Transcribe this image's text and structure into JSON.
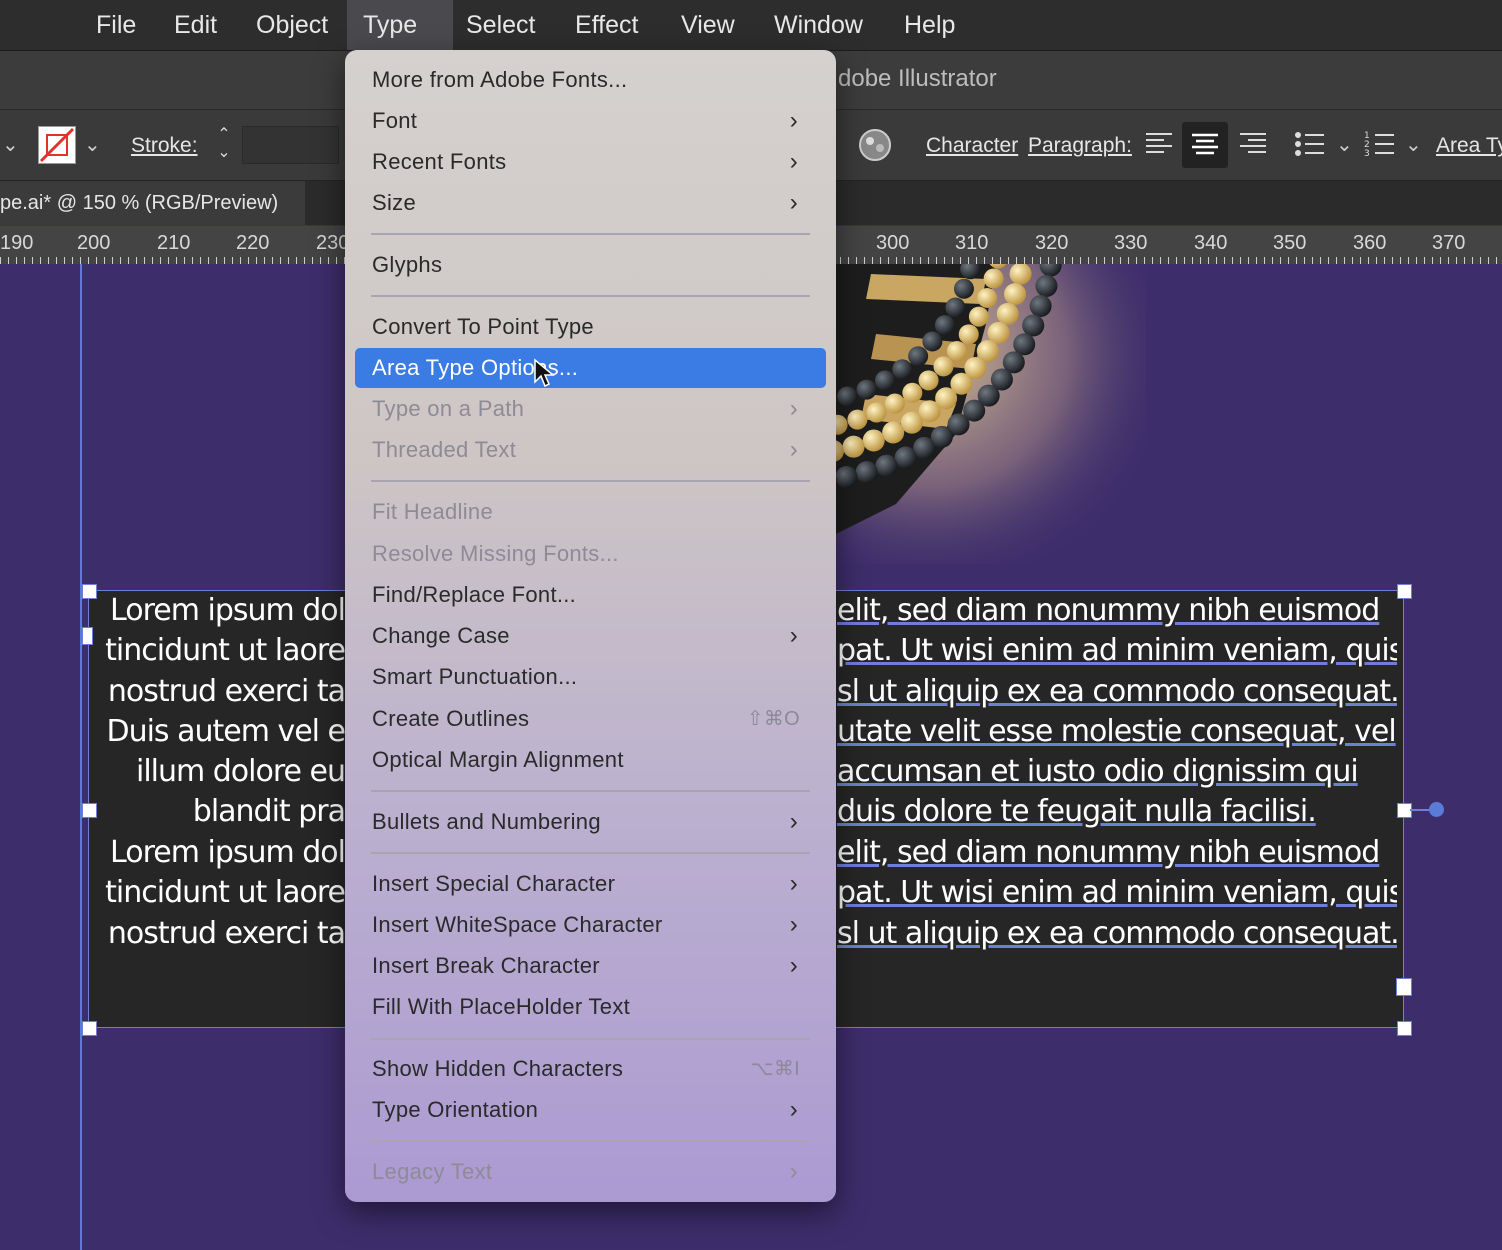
{
  "menubar": {
    "items": [
      "File",
      "Edit",
      "Object",
      "Type",
      "Select",
      "Effect",
      "View",
      "Window",
      "Help"
    ],
    "active": "Type"
  },
  "titlebar": {
    "title": "dobe Illustrator"
  },
  "controlbar": {
    "stroke_label": "Stroke:",
    "character_label": "Character",
    "paragraph_label": "Paragraph:",
    "area_label": "Area Ty"
  },
  "document": {
    "tab_label": "pe.ai* @ 150 % (RGB/Preview)"
  },
  "ruler": {
    "labels": [
      "190",
      "200",
      "210",
      "220",
      "230",
      "300",
      "310",
      "320",
      "330",
      "340",
      "350",
      "360",
      "370"
    ]
  },
  "type_menu": {
    "items": [
      {
        "label": "More from Adobe Fonts...",
        "submenu": false,
        "disabled": false
      },
      {
        "label": "Font",
        "submenu": true,
        "disabled": false
      },
      {
        "label": "Recent Fonts",
        "submenu": true,
        "disabled": false
      },
      {
        "label": "Size",
        "submenu": true,
        "disabled": false
      },
      {
        "label": "Glyphs",
        "submenu": false,
        "disabled": false
      },
      {
        "label": "Convert To Point Type",
        "submenu": false,
        "disabled": false
      },
      {
        "label": "Area Type Options...",
        "submenu": false,
        "disabled": false,
        "selected": true
      },
      {
        "label": "Type on a Path",
        "submenu": true,
        "disabled": true
      },
      {
        "label": "Threaded Text",
        "submenu": true,
        "disabled": true
      },
      {
        "label": "Fit Headline",
        "submenu": false,
        "disabled": true
      },
      {
        "label": "Resolve Missing Fonts...",
        "submenu": false,
        "disabled": true
      },
      {
        "label": "Find/Replace Font...",
        "submenu": false,
        "disabled": false
      },
      {
        "label": "Change Case",
        "submenu": true,
        "disabled": false
      },
      {
        "label": "Smart Punctuation...",
        "submenu": false,
        "disabled": false
      },
      {
        "label": "Create Outlines",
        "submenu": false,
        "disabled": false,
        "shortcut": "⇧⌘O"
      },
      {
        "label": "Optical Margin Alignment",
        "submenu": false,
        "disabled": false
      },
      {
        "label": "Bullets and Numbering",
        "submenu": true,
        "disabled": false
      },
      {
        "label": "Insert Special Character",
        "submenu": true,
        "disabled": false
      },
      {
        "label": "Insert WhiteSpace Character",
        "submenu": true,
        "disabled": false
      },
      {
        "label": "Insert Break Character",
        "submenu": true,
        "disabled": false
      },
      {
        "label": "Fill With PlaceHolder Text",
        "submenu": false,
        "disabled": false
      },
      {
        "label": "Show Hidden Characters",
        "submenu": false,
        "disabled": false,
        "shortcut": "⌥⌘I"
      },
      {
        "label": "Type Orientation",
        "submenu": true,
        "disabled": false
      },
      {
        "label": "Legacy Text",
        "submenu": true,
        "disabled": true
      }
    ]
  },
  "text_frame": {
    "left_lines": [
      "Lorem ipsum dol",
      "tincidunt ut laore",
      "nostrud exerci ta",
      "Duis autem vel e",
      "illum dolore eu",
      "blandit pra",
      "Lorem ipsum dol",
      "tincidunt ut laore",
      "nostrud exerci ta"
    ],
    "right_lines": [
      "elit, sed diam nonummy nibh euismod",
      "pat. Ut wisi enim ad minim veniam, quis",
      "sl ut aliquip ex ea commodo consequat.",
      "utate velit esse molestie consequat, vel",
      "accumsan et iusto odio dignissim qui",
      "duis dolore te feugait nulla facilisi.",
      "elit, sed diam nonummy nibh euismod",
      "pat. Ut wisi enim ad minim veniam, quis",
      "sl ut aliquip ex ea commodo consequat."
    ]
  }
}
